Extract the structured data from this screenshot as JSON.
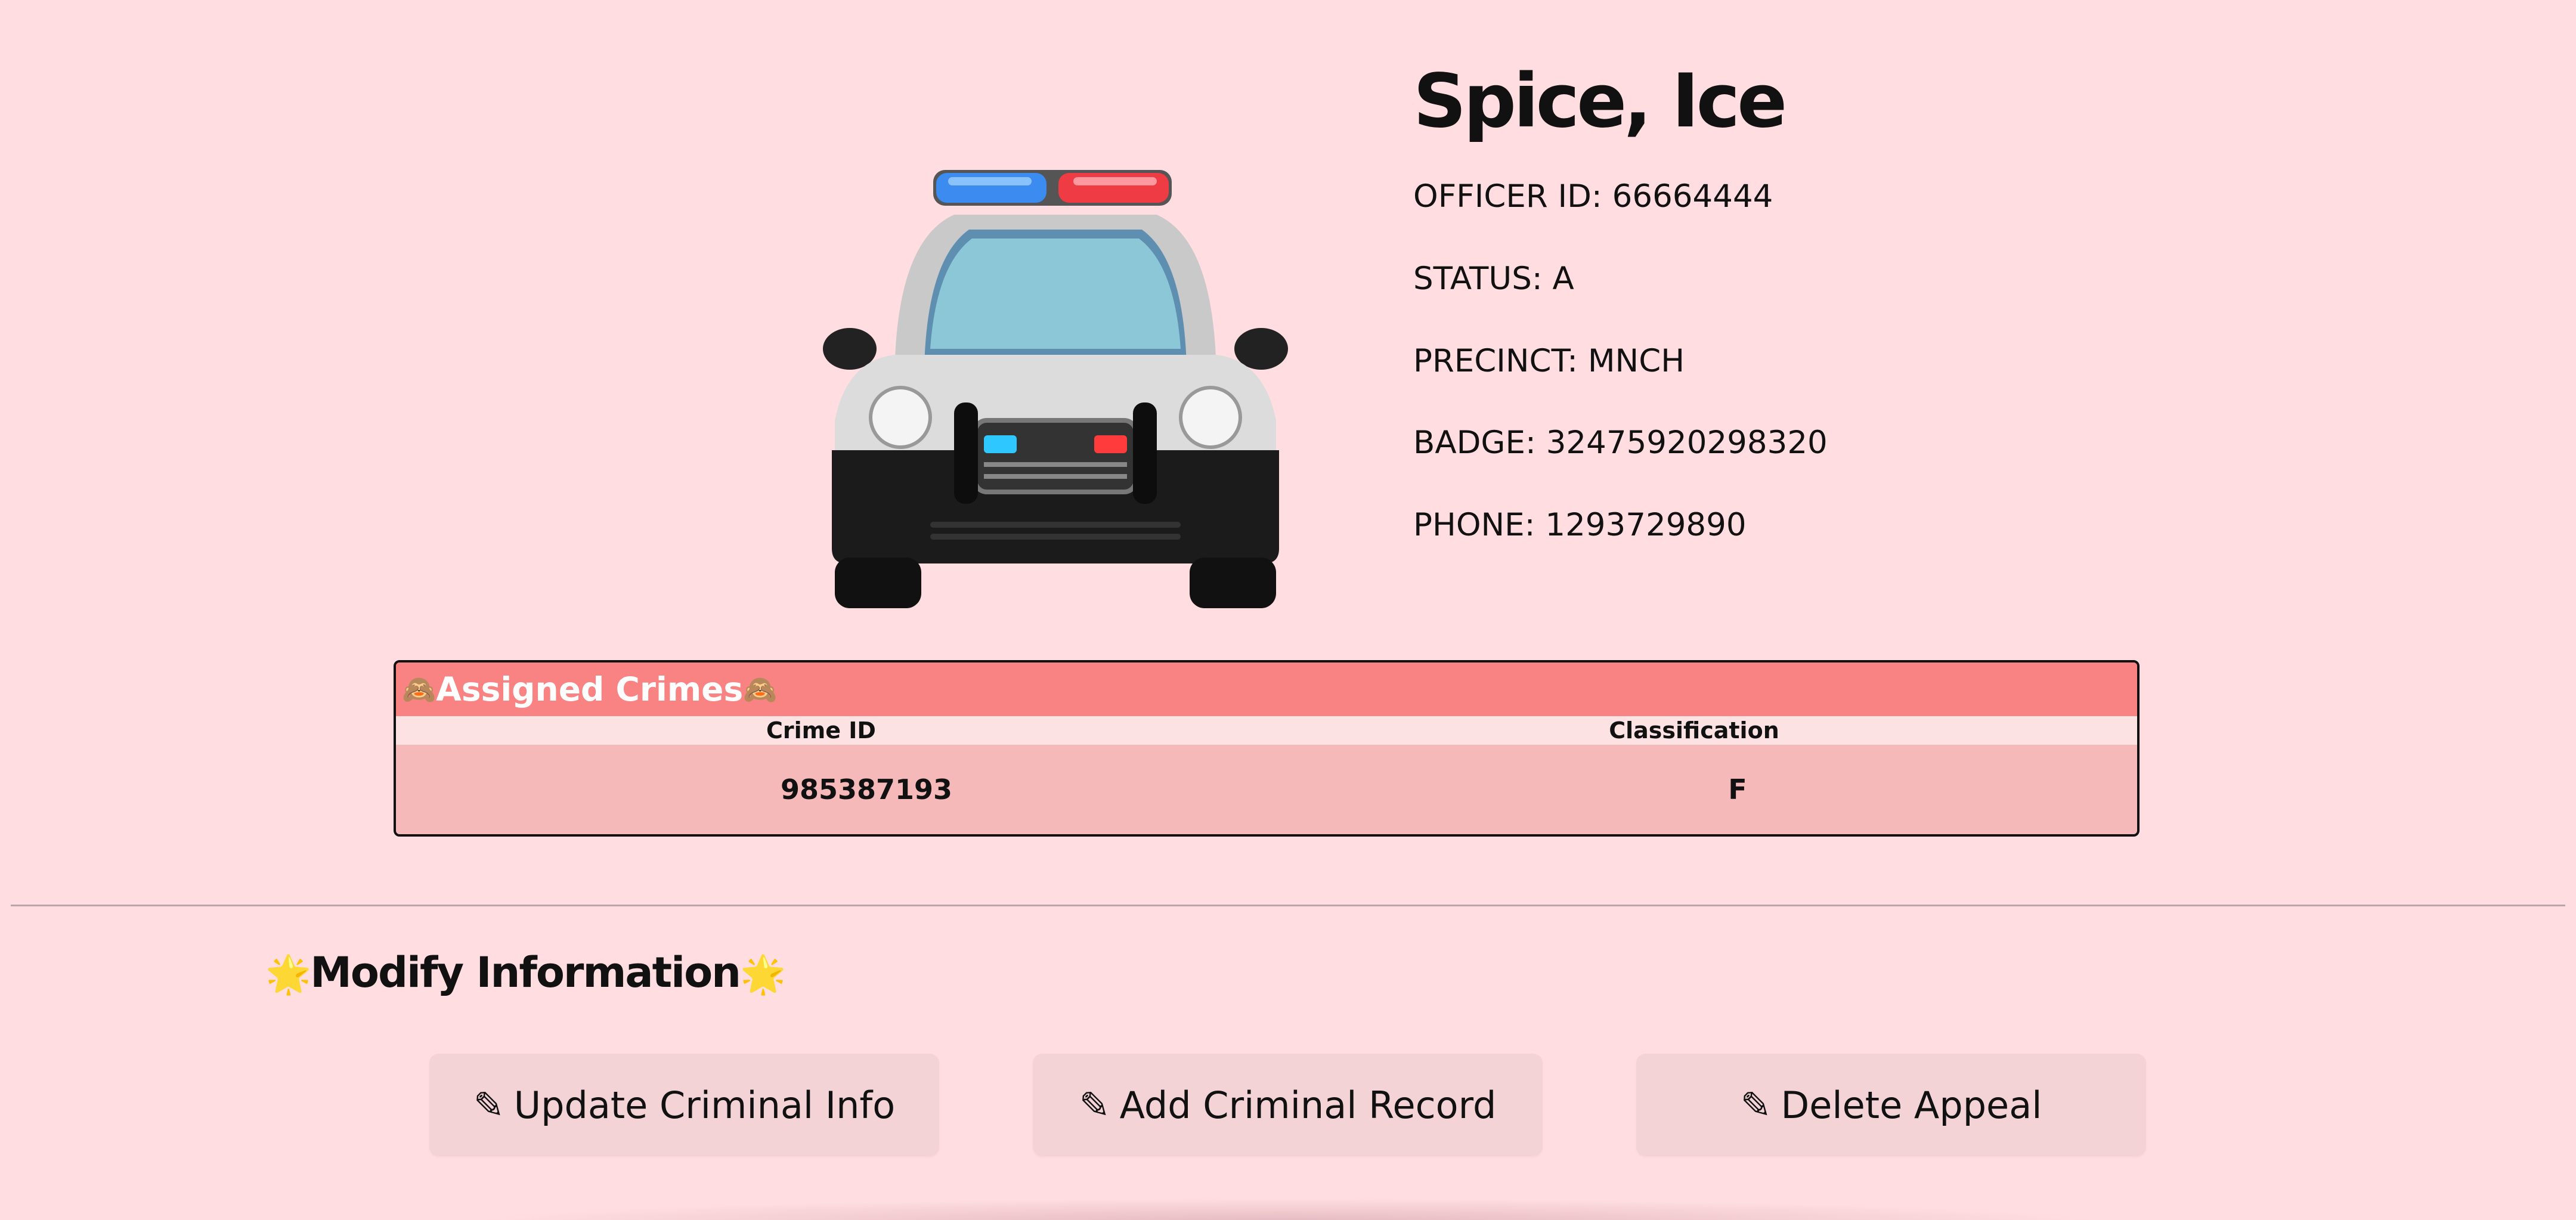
{
  "officer": {
    "name": "Spice, Ice",
    "officer_id": "OFFICER ID: 66664444",
    "status": "STATUS: A",
    "precinct": "PRECINCT: MNCH",
    "badge": "BADGE: 32475920298320",
    "phone": "PHONE: 1293729890",
    "avatar_icon": "police-car-icon"
  },
  "crimes": {
    "title": "Assigned Crimes",
    "title_icon": "see-no-evil-monkey-icon",
    "columns": [
      "Crime ID",
      "Classification"
    ],
    "rows": [
      [
        "985387193",
        "F"
      ]
    ]
  },
  "modify": {
    "title": "Modify Information",
    "title_icon": "glowing-star-icon",
    "buttons": [
      {
        "label": "Update Criminal Info",
        "icon": "pencil-icon"
      },
      {
        "label": "Add Criminal Record",
        "icon": "pencil-icon"
      },
      {
        "label": "Delete Appeal",
        "icon": "pencil-icon"
      }
    ]
  },
  "colors": {
    "background": "#ffdde1",
    "table_header": "#f98383",
    "table_body": "#f6b9ba",
    "button": "#f3d3d6"
  }
}
